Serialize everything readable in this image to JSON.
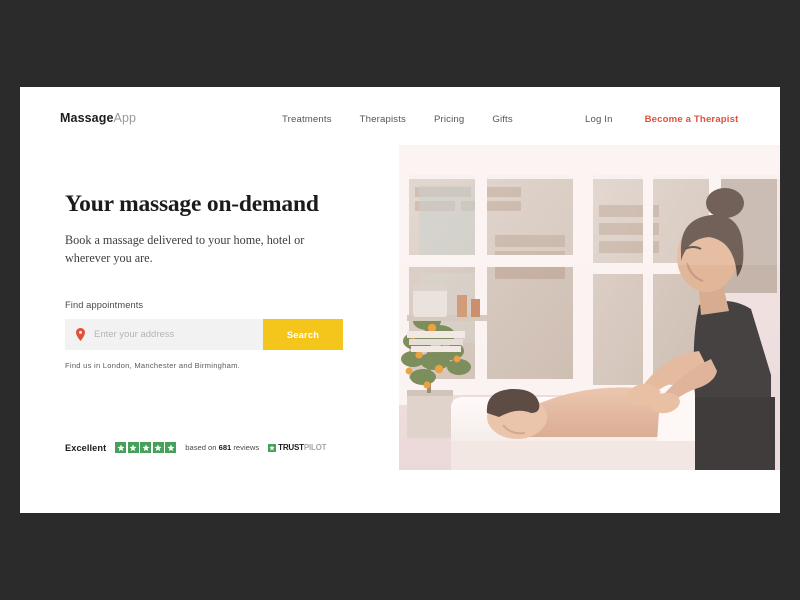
{
  "page": {
    "background_color": "#2b2b2b",
    "card_color": "#ffffff"
  },
  "header": {
    "brand": {
      "strong": "Massage",
      "light": "App"
    },
    "nav_items": [
      {
        "label": "Treatments"
      },
      {
        "label": "Therapists"
      },
      {
        "label": "Pricing"
      },
      {
        "label": "Gifts"
      }
    ],
    "login_label": "Log In",
    "cta_label": "Become a Therapist",
    "cta_color": "#e0513d"
  },
  "hero": {
    "title": "Your massage on-demand",
    "subtitle": "Book a massage delivered to your home, hotel or wherever you are."
  },
  "search": {
    "label": "Find appointments",
    "placeholder": "Enter your address",
    "value": "",
    "button_label": "Search",
    "button_color": "#f4c61c",
    "field_color": "#f2f2f2",
    "pin_color": "#e0513d",
    "hint": "Find us in London, Manchester and Birmingham."
  },
  "trustpilot": {
    "rating_word": "Excellent",
    "stars": 5,
    "star_color": "#46a05a",
    "reviews_prefix": "based on ",
    "reviews_count": "681",
    "reviews_suffix": " reviews",
    "logo_trust": "TRUST",
    "logo_pilot": "PILOT"
  },
  "hero_image": {
    "alt": "Massage therapist giving a back massage to a client lying on a massage table in a bright room with large windows and a potted citrus plant"
  }
}
